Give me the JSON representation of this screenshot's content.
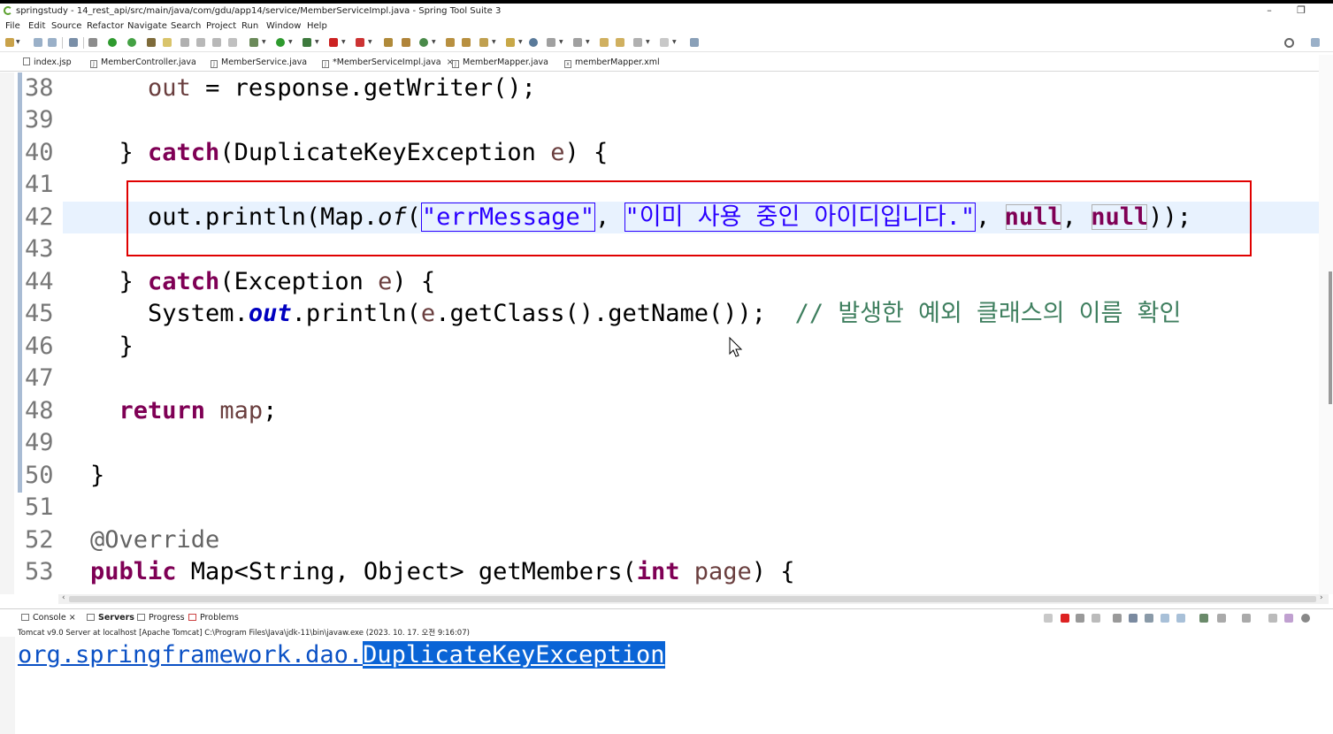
{
  "window": {
    "title": "springstudy - 14_rest_api/src/main/java/com/gdu/app14/service/MemberServiceImpl.java - Spring Tool Suite 3",
    "minimize": "–",
    "restore": "❐"
  },
  "menu": [
    "File",
    "Edit",
    "Source",
    "Refactor",
    "Navigate",
    "Search",
    "Project",
    "Run",
    "Window",
    "Help"
  ],
  "tabs": [
    {
      "label": "index.jsp",
      "icon": "jsp-file-icon"
    },
    {
      "label": "MemberController.java",
      "icon": "java-file-icon"
    },
    {
      "label": "MemberService.java",
      "icon": "java-file-icon"
    },
    {
      "label": "*MemberServiceImpl.java",
      "icon": "java-file-icon",
      "active": true,
      "close": "×"
    },
    {
      "label": "MemberMapper.java",
      "icon": "java-file-icon"
    },
    {
      "label": "memberMapper.xml",
      "icon": "xml-file-icon"
    }
  ],
  "editor": {
    "current_line": "42",
    "lines": [
      {
        "n": "38",
        "text": "    out = response.getWriter();"
      },
      {
        "n": "39",
        "text": ""
      },
      {
        "n": "40",
        "text": "  } catch(DuplicateKeyException e) {"
      },
      {
        "n": "41",
        "text": ""
      },
      {
        "n": "42",
        "text": "    out.println(Map.of(\"errMessage\", \"이미 사용 중인 아이디입니다.\", null, null));"
      },
      {
        "n": "43",
        "text": ""
      },
      {
        "n": "44",
        "text": "  } catch(Exception e) {"
      },
      {
        "n": "45",
        "text": "    System.out.println(e.getClass().getName());  // 발생한 예외 클래스의 이름 확인"
      },
      {
        "n": "46",
        "text": "  }"
      },
      {
        "n": "47",
        "text": ""
      },
      {
        "n": "48",
        "text": "  return map;"
      },
      {
        "n": "49",
        "text": ""
      },
      {
        "n": "50",
        "text": "}"
      },
      {
        "n": "51",
        "text": ""
      },
      {
        "n": "52",
        "text": "@Override"
      },
      {
        "n": "53",
        "text": "public Map<String, Object> getMembers(int page) {"
      }
    ],
    "tokens": {
      "l38_out": "out",
      "l38_rest": " = response.getWriter();",
      "l40_a": "} ",
      "l40_catch": "catch",
      "l40_b": "(DuplicateKeyException ",
      "l40_e": "e",
      "l40_c": ") {",
      "l42_a": "out.println(Map.",
      "l42_of": "of",
      "l42_b": "(",
      "l42_s1": "\"errMessage\"",
      "l42_c": ", ",
      "l42_s2": "\"이미 사용 중인 아이디입니다.\"",
      "l42_d": ", ",
      "l42_null1": "null",
      "l42_e": ", ",
      "l42_null2": "null",
      "l42_f": "));",
      "l44_a": "} ",
      "l44_catch": "catch",
      "l44_b": "(Exception ",
      "l44_e": "e",
      "l44_c": ") {",
      "l45_a": "System.",
      "l45_out": "out",
      "l45_b": ".println(",
      "l45_e": "e",
      "l45_c": ".getClass().getName());  ",
      "l45_cmt": "// 발생한 예외 클래스의 이름 확인",
      "l46": "}",
      "l48_return": "return",
      "l48_sp": " ",
      "l48_map": "map",
      "l48_semi": ";",
      "l50": "}",
      "l52": "@Override",
      "l53_public": "public",
      "l53_a": " Map<String, Object> getMembers(",
      "l53_int": "int",
      "l53_sp": " ",
      "l53_page": "page",
      "l53_b": ") {"
    }
  },
  "console": {
    "tabs": [
      {
        "label": "Console",
        "close": "×"
      },
      {
        "label": "Servers"
      },
      {
        "label": "Progress"
      },
      {
        "label": "Problems"
      }
    ],
    "status": "Tomcat v9.0 Server at localhost [Apache Tomcat] C:\\Program Files\\Java\\jdk-11\\bin\\javaw.exe  (2023. 10. 17. 오전 9:16:07)",
    "output_prefix": "org.springframework.dao.",
    "output_selected": "DuplicateKeyException"
  },
  "colors": {
    "keyword": "#7f0055",
    "string": "#2a00ff",
    "comment": "#3f7f5f",
    "highlight_box": "#e00000",
    "selection": "#0a64d6"
  }
}
